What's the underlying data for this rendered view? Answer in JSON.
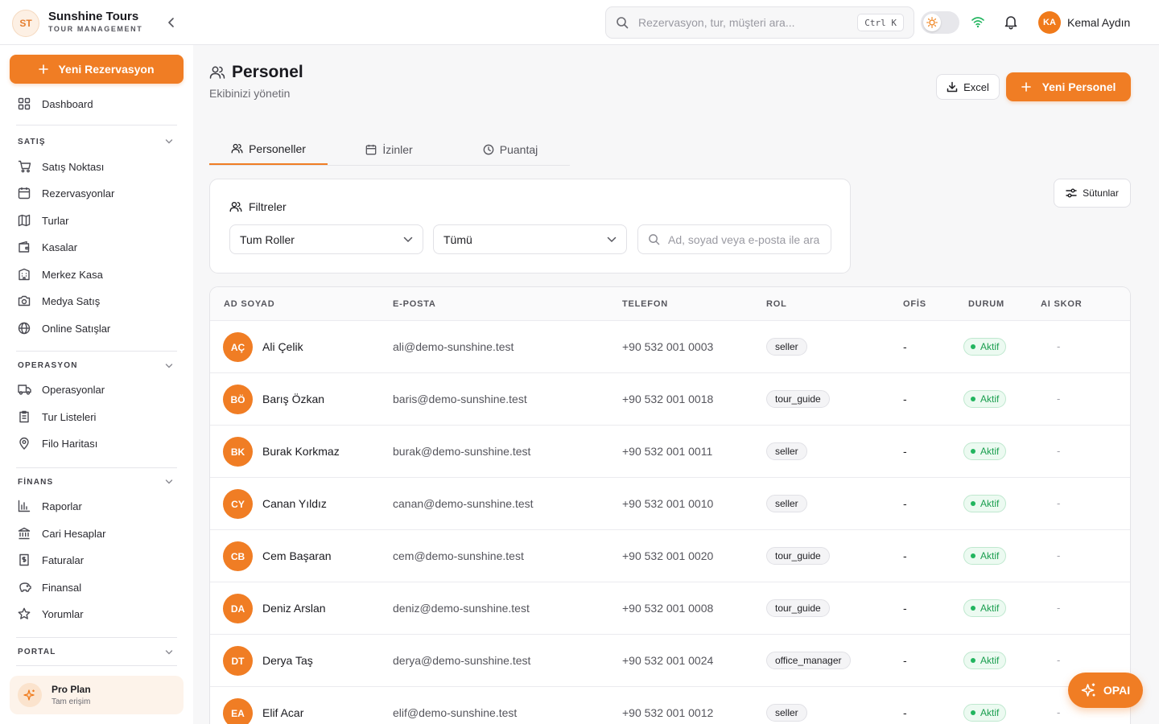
{
  "brand": {
    "initials": "ST",
    "name": "Sunshine Tours",
    "subtitle": "TOUR MANAGEMENT"
  },
  "header": {
    "search_placeholder": "Rezervasyon, tur, müşteri ara...",
    "search_shortcut": "Ctrl K",
    "user": {
      "initials": "KA",
      "name": "Kemal Aydın"
    }
  },
  "sidebar": {
    "new_reservation_label": "Yeni Rezervasyon",
    "dashboard_label": "Dashboard",
    "sections": {
      "satis": {
        "label": "SATIŞ",
        "items": [
          "Satış Noktası",
          "Rezervasyonlar",
          "Turlar",
          "Kasalar",
          "Merkez Kasa",
          "Medya Satış",
          "Online Satışlar"
        ]
      },
      "operasyon": {
        "label": "OPERASYON",
        "items": [
          "Operasyonlar",
          "Tur Listeleri",
          "Filo Haritası"
        ]
      },
      "finans": {
        "label": "FİNANS",
        "items": [
          "Raporlar",
          "Cari Hesaplar",
          "Faturalar",
          "Finansal",
          "Yorumlar"
        ]
      },
      "portal": {
        "label": "PORTAL"
      }
    },
    "plan": {
      "title": "Pro Plan",
      "subtitle": "Tam erişim"
    }
  },
  "page": {
    "title": "Personel",
    "subtitle": "Ekibinizi yönetin",
    "excel_label": "Excel",
    "new_staff_label": "Yeni Personel",
    "columns_label": "Sütunlar"
  },
  "tabs": [
    {
      "label": "Personeller",
      "icon": "users-icon",
      "active": true
    },
    {
      "label": "İzinler",
      "icon": "calendar-icon",
      "active": false
    },
    {
      "label": "Puantaj",
      "icon": "clock-icon",
      "active": false
    }
  ],
  "filters": {
    "title": "Filtreler",
    "role_value": "Tum Roller",
    "status_value": "Tümü",
    "search_placeholder": "Ad, soyad veya e-posta ile ara"
  },
  "table": {
    "columns": [
      "AD SOYAD",
      "E-POSTA",
      "TELEFON",
      "ROL",
      "OFİS",
      "DURUM",
      "AI SKOR"
    ],
    "rows": [
      {
        "initials": "AÇ",
        "name": "Ali Çelik",
        "email": "ali@demo-sunshine.test",
        "phone": "+90 532 001 0003",
        "role": "seller",
        "office": "-",
        "status": "Aktif",
        "ai": "-"
      },
      {
        "initials": "BÖ",
        "name": "Barış Özkan",
        "email": "baris@demo-sunshine.test",
        "phone": "+90 532 001 0018",
        "role": "tour_guide",
        "office": "-",
        "status": "Aktif",
        "ai": "-"
      },
      {
        "initials": "BK",
        "name": "Burak Korkmaz",
        "email": "burak@demo-sunshine.test",
        "phone": "+90 532 001 0011",
        "role": "seller",
        "office": "-",
        "status": "Aktif",
        "ai": "-"
      },
      {
        "initials": "CY",
        "name": "Canan Yıldız",
        "email": "canan@demo-sunshine.test",
        "phone": "+90 532 001 0010",
        "role": "seller",
        "office": "-",
        "status": "Aktif",
        "ai": "-"
      },
      {
        "initials": "CB",
        "name": "Cem Başaran",
        "email": "cem@demo-sunshine.test",
        "phone": "+90 532 001 0020",
        "role": "tour_guide",
        "office": "-",
        "status": "Aktif",
        "ai": "-"
      },
      {
        "initials": "DA",
        "name": "Deniz Arslan",
        "email": "deniz@demo-sunshine.test",
        "phone": "+90 532 001 0008",
        "role": "tour_guide",
        "office": "-",
        "status": "Aktif",
        "ai": "-"
      },
      {
        "initials": "DT",
        "name": "Derya Taş",
        "email": "derya@demo-sunshine.test",
        "phone": "+90 532 001 0024",
        "role": "office_manager",
        "office": "-",
        "status": "Aktif",
        "ai": "-"
      },
      {
        "initials": "EA",
        "name": "Elif Acar",
        "email": "elif@demo-sunshine.test",
        "phone": "+90 532 001 0012",
        "role": "seller",
        "office": "-",
        "status": "Aktif",
        "ai": "-"
      }
    ]
  },
  "assistant": {
    "label": "OPAI"
  },
  "colors": {
    "accent": "#f07d24",
    "success": "#22b55f"
  }
}
